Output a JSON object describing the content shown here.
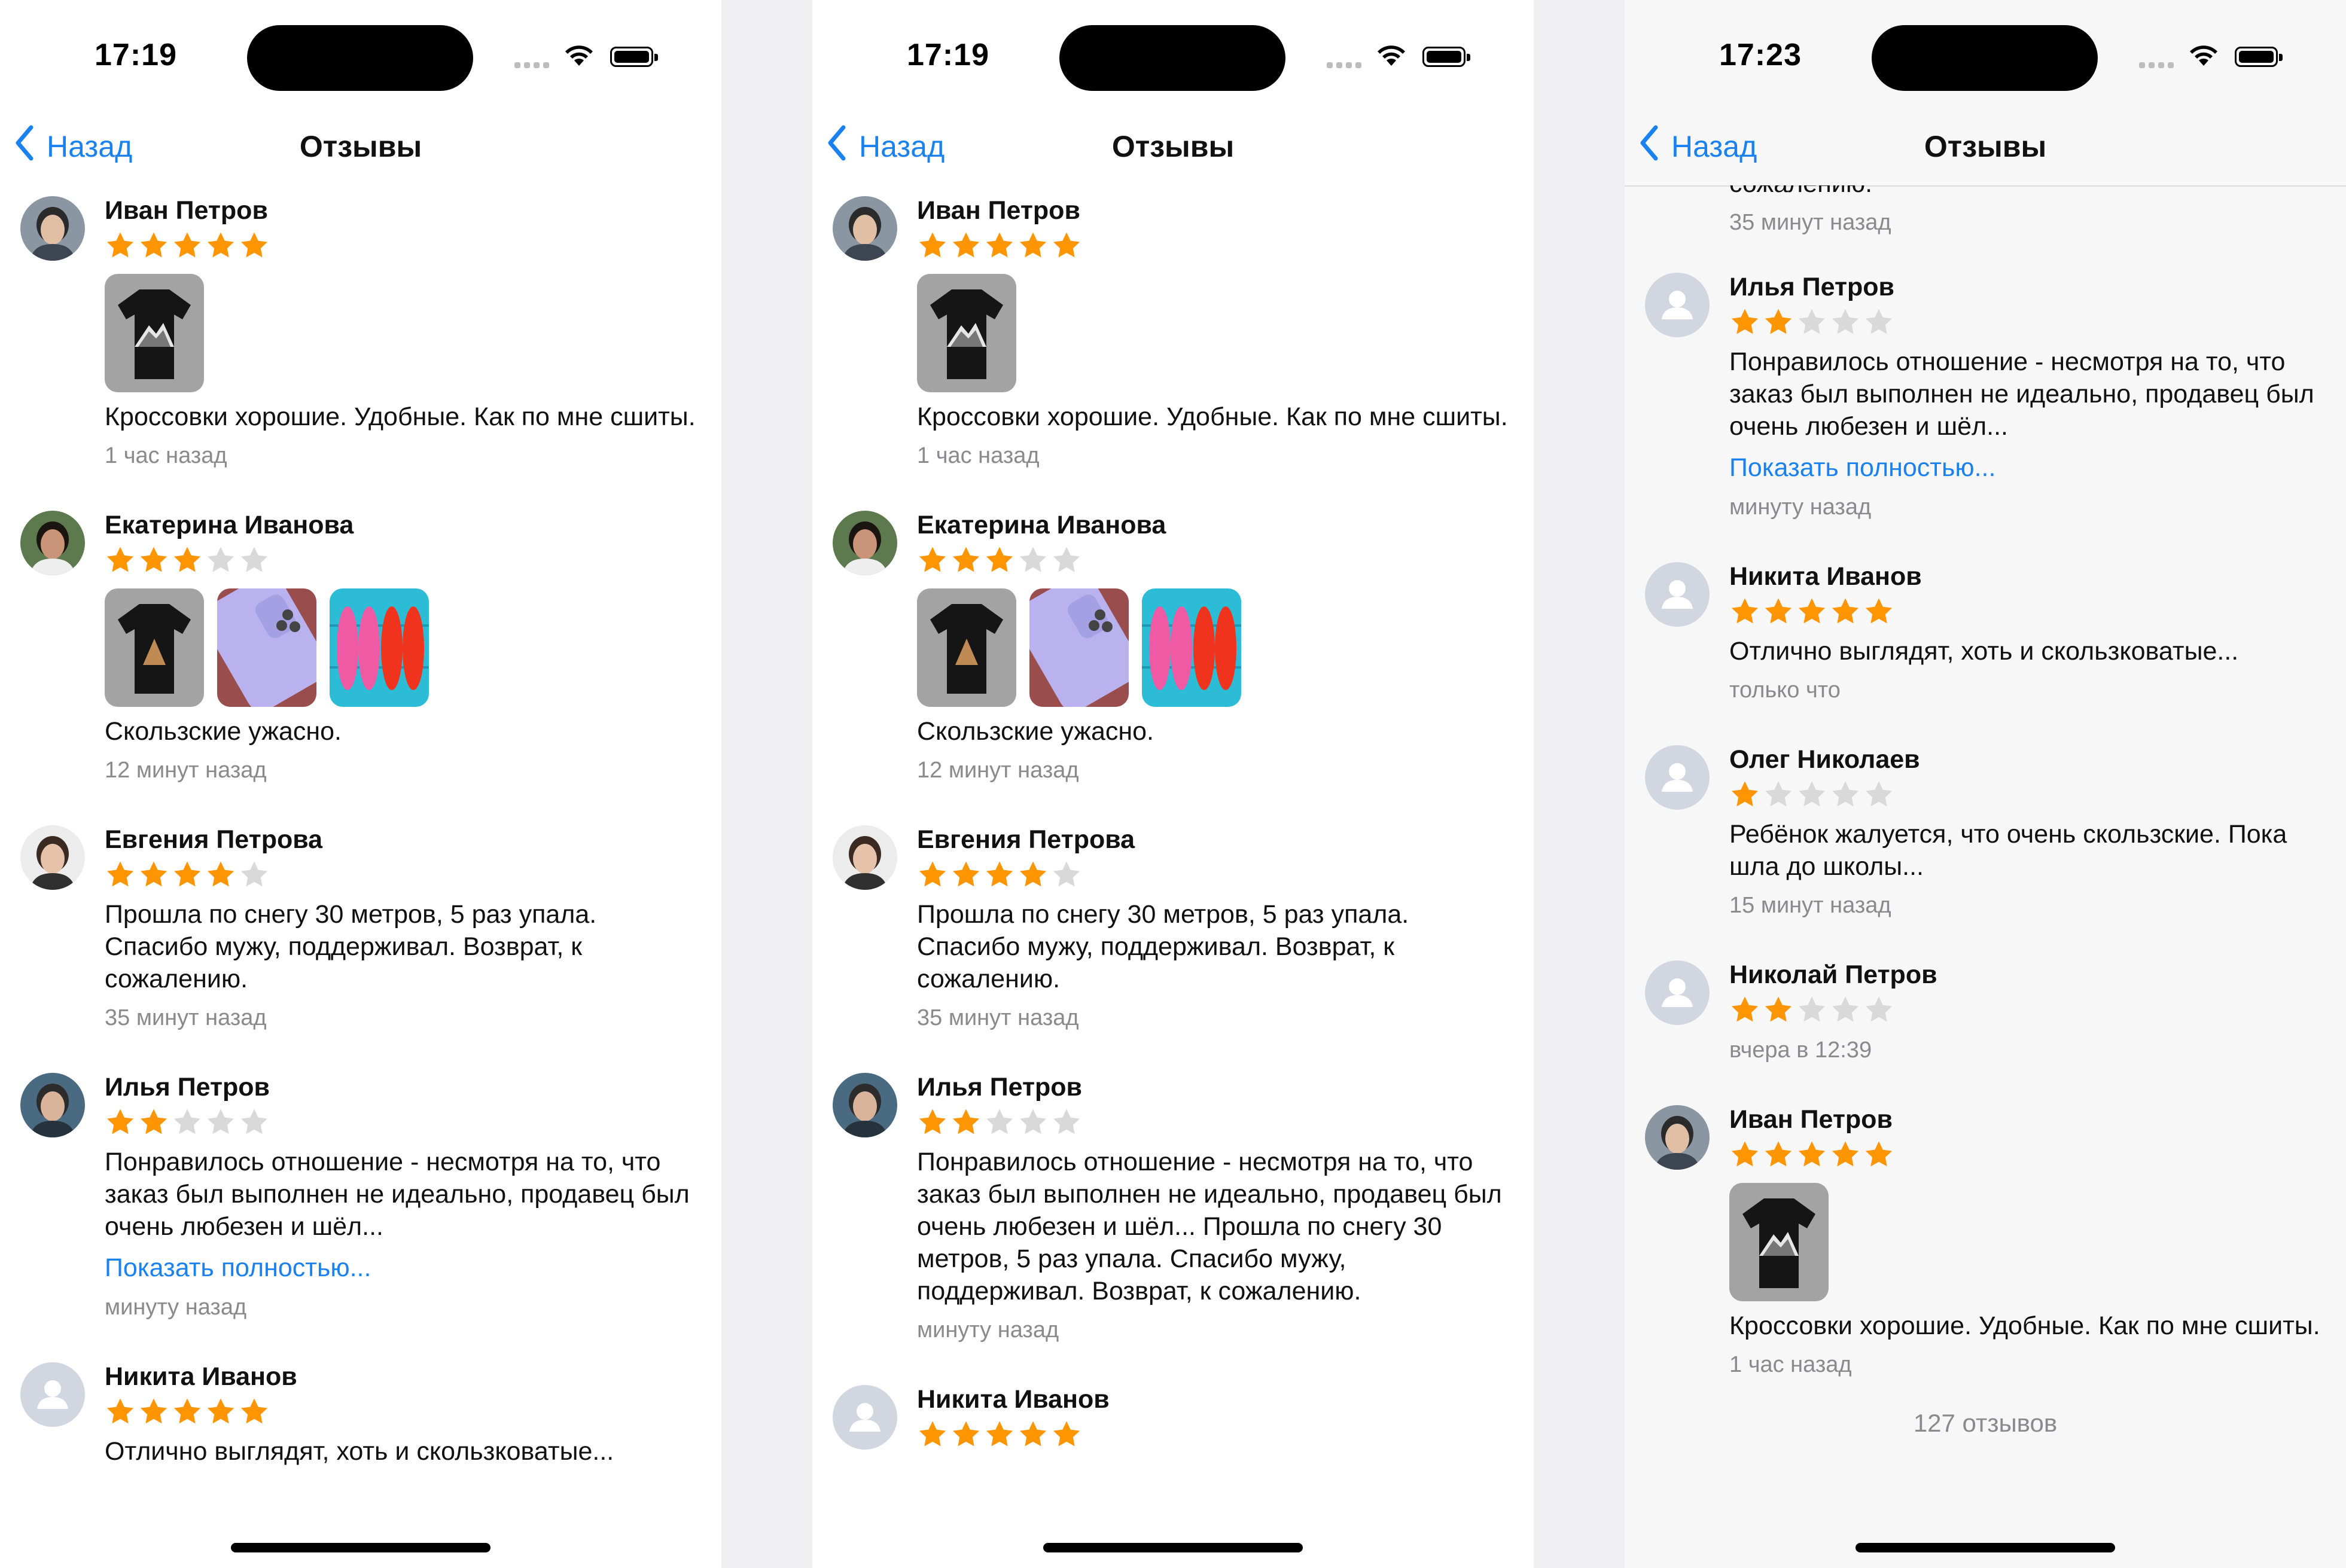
{
  "screens": [
    {
      "time": "17:19",
      "nav": {
        "back_label": "Назад",
        "title": "Отзывы"
      },
      "reviews": [
        {
          "name": "Иван Петров",
          "rating": 5,
          "avatar": "man-photo-avatar",
          "photos": [
            "black-tshirt-mountain"
          ],
          "text": "Кроссовки хорошие. Удобные. Как по мне сшиты.",
          "date": "1 час назад"
        },
        {
          "name": "Екатерина Иванова",
          "rating": 3,
          "avatar": "woman-photo-avatar",
          "photos": [
            "black-tshirt-pyramid",
            "lilac-phone",
            "flip-flops"
          ],
          "text": "Скользские ужасно.",
          "date": "12 минут назад"
        },
        {
          "name": "Евгения Петрова",
          "rating": 4,
          "avatar": "woman-photo-avatar-2",
          "photos": [],
          "text": "Прошла по снегу 30 метров, 5 раз упала. Спасибо мужу, поддерживал. Возврат, к сожалению.",
          "date": "35 минут назад"
        },
        {
          "name": "Илья Петров",
          "rating": 2,
          "avatar": "man-photo-avatar-2",
          "photos": [],
          "text": "Понравилось отношение - несмотря на то, что заказ был выполнен не идеально, продавец был очень любезен и шёл...",
          "more": "Показать полностью...",
          "date": "минуту назад"
        },
        {
          "name": "Никита Иванов",
          "rating": 5,
          "avatar": "placeholder-avatar",
          "photos": [],
          "text": "Отлично выглядят, хоть и скользковатые..."
        }
      ]
    },
    {
      "time": "17:19",
      "nav": {
        "back_label": "Назад",
        "title": "Отзывы"
      },
      "reviews": [
        {
          "name": "Иван Петров",
          "rating": 5,
          "avatar": "man-photo-avatar",
          "photos": [
            "black-tshirt-mountain"
          ],
          "text": "Кроссовки хорошие. Удобные. Как по мне сшиты.",
          "date": "1 час назад"
        },
        {
          "name": "Екатерина Иванова",
          "rating": 3,
          "avatar": "woman-photo-avatar",
          "photos": [
            "black-tshirt-pyramid",
            "lilac-phone",
            "flip-flops"
          ],
          "text": "Скользские ужасно.",
          "date": "12 минут назад"
        },
        {
          "name": "Евгения Петрова",
          "rating": 4,
          "avatar": "woman-photo-avatar-2",
          "photos": [],
          "text": "Прошла по снегу 30 метров, 5 раз упала. Спасибо мужу, поддерживал. Возврат, к сожалению.",
          "date": "35 минут назад"
        },
        {
          "name": "Илья Петров",
          "rating": 2,
          "avatar": "man-photo-avatar-2",
          "photos": [],
          "text": "Понравилось отношение - несмотря на то, что заказ был выполнен не идеально, продавец был очень любезен и шёл... Прошла по снегу 30 метров, 5 раз упала. Спасибо мужу, поддерживал. Возврат, к сожалению.",
          "date": "минуту назад"
        },
        {
          "name": "Никита Иванов",
          "rating": 5,
          "avatar": "placeholder-avatar",
          "photos": []
        }
      ]
    },
    {
      "time": "17:23",
      "nav": {
        "back_label": "Назад",
        "title": "Отзывы"
      },
      "partial_top": {
        "text": "сожалению.",
        "date": "35 минут назад"
      },
      "reviews": [
        {
          "name": "Илья Петров",
          "rating": 2,
          "avatar": "placeholder-avatar",
          "photos": [],
          "text": "Понравилось отношение - несмотря на то, что заказ был выполнен не идеально, продавец был очень любезен и шёл...",
          "more": "Показать полностью...",
          "date": "минуту назад"
        },
        {
          "name": "Никита Иванов",
          "rating": 5,
          "avatar": "placeholder-avatar",
          "photos": [],
          "text": "Отлично выглядят, хоть и скользковатые...",
          "date": "только что"
        },
        {
          "name": "Олег Николаев",
          "rating": 1,
          "avatar": "placeholder-avatar",
          "photos": [],
          "text": "Ребёнок жалуется, что очень скользские. Пока шла до школы...",
          "date": "15 минут назад"
        },
        {
          "name": "Николай Петров",
          "rating": 2,
          "avatar": "placeholder-avatar",
          "photos": [],
          "date": "вчера в 12:39"
        },
        {
          "name": "Иван Петров",
          "rating": 5,
          "avatar": "man-photo-avatar",
          "photos": [
            "black-tshirt-mountain"
          ],
          "text": "Кроссовки хорошие. Удобные. Как по мне сшиты.",
          "date": "1 час назад"
        }
      ],
      "footer_count": "127 отзывов"
    }
  ],
  "colors": {
    "accent": "#1a82f0",
    "star_on": "#ff9500",
    "star_off": "#d9d9d9",
    "secondary_text": "#8a8a8e"
  }
}
